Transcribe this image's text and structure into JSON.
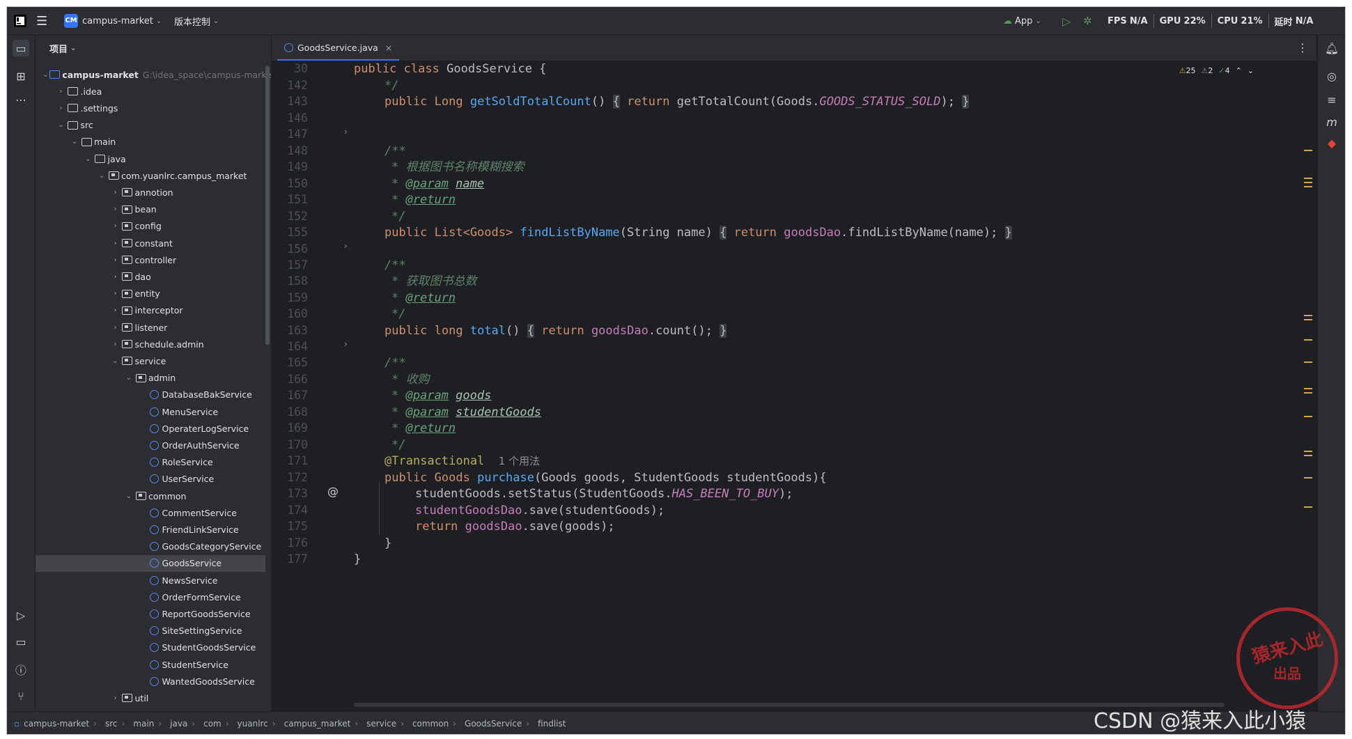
{
  "titlebar": {
    "project_badge": "CM",
    "project_name": "campus-market",
    "vcs": "版本控制",
    "run_config": "App",
    "fps_label": "FPS",
    "fps_value": "N/A",
    "gpu_label": "GPU",
    "gpu_value": "22%",
    "cpu_label": "CPU",
    "cpu_value": "21%",
    "time_label": "延时",
    "time_value": "N/A"
  },
  "project_panel": {
    "title": "项目",
    "tree": [
      {
        "label": "campus-market",
        "extra": "G:\\idea_space\\campus-market",
        "depth": 0,
        "type": "module",
        "arrow": "open"
      },
      {
        "label": ".idea",
        "depth": 1,
        "type": "folder",
        "arrow": "closed"
      },
      {
        "label": ".settings",
        "depth": 1,
        "type": "folder",
        "arrow": "closed"
      },
      {
        "label": "src",
        "depth": 1,
        "type": "folder",
        "arrow": "open"
      },
      {
        "label": "main",
        "depth": 2,
        "type": "folder",
        "arrow": "open"
      },
      {
        "label": "java",
        "depth": 3,
        "type": "folder",
        "arrow": "open"
      },
      {
        "label": "com.yuanlrc.campus_market",
        "depth": 4,
        "type": "package",
        "arrow": "open"
      },
      {
        "label": "annotion",
        "depth": 5,
        "type": "package",
        "arrow": "closed"
      },
      {
        "label": "bean",
        "depth": 5,
        "type": "package",
        "arrow": "closed"
      },
      {
        "label": "config",
        "depth": 5,
        "type": "package",
        "arrow": "closed"
      },
      {
        "label": "constant",
        "depth": 5,
        "type": "package",
        "arrow": "closed"
      },
      {
        "label": "controller",
        "depth": 5,
        "type": "package",
        "arrow": "closed"
      },
      {
        "label": "dao",
        "depth": 5,
        "type": "package",
        "arrow": "closed"
      },
      {
        "label": "entity",
        "depth": 5,
        "type": "package",
        "arrow": "closed"
      },
      {
        "label": "interceptor",
        "depth": 5,
        "type": "package",
        "arrow": "closed"
      },
      {
        "label": "listener",
        "depth": 5,
        "type": "package",
        "arrow": "closed"
      },
      {
        "label": "schedule.admin",
        "depth": 5,
        "type": "package",
        "arrow": "closed"
      },
      {
        "label": "service",
        "depth": 5,
        "type": "package",
        "arrow": "open"
      },
      {
        "label": "admin",
        "depth": 6,
        "type": "package",
        "arrow": "open"
      },
      {
        "label": "DatabaseBakService",
        "depth": 7,
        "type": "class"
      },
      {
        "label": "MenuService",
        "depth": 7,
        "type": "class"
      },
      {
        "label": "OperaterLogService",
        "depth": 7,
        "type": "class"
      },
      {
        "label": "OrderAuthService",
        "depth": 7,
        "type": "class"
      },
      {
        "label": "RoleService",
        "depth": 7,
        "type": "class"
      },
      {
        "label": "UserService",
        "depth": 7,
        "type": "class"
      },
      {
        "label": "common",
        "depth": 6,
        "type": "package",
        "arrow": "open"
      },
      {
        "label": "CommentService",
        "depth": 7,
        "type": "class"
      },
      {
        "label": "FriendLinkService",
        "depth": 7,
        "type": "class"
      },
      {
        "label": "GoodsCategoryService",
        "depth": 7,
        "type": "class"
      },
      {
        "label": "GoodsService",
        "depth": 7,
        "type": "class",
        "selected": true
      },
      {
        "label": "NewsService",
        "depth": 7,
        "type": "class"
      },
      {
        "label": "OrderFormService",
        "depth": 7,
        "type": "class"
      },
      {
        "label": "ReportGoodsService",
        "depth": 7,
        "type": "class"
      },
      {
        "label": "SiteSettingService",
        "depth": 7,
        "type": "class"
      },
      {
        "label": "StudentGoodsService",
        "depth": 7,
        "type": "class"
      },
      {
        "label": "StudentService",
        "depth": 7,
        "type": "class"
      },
      {
        "label": "WantedGoodsService",
        "depth": 7,
        "type": "class"
      },
      {
        "label": "util",
        "depth": 5,
        "type": "package",
        "arrow": "closed"
      }
    ]
  },
  "editor": {
    "tab": "GoodsService.java",
    "warnings": "25",
    "weak_warnings": "2",
    "typos": "4",
    "line_numbers": [
      "30",
      "142",
      "143",
      "146",
      "147",
      "148",
      "149",
      "150",
      "151",
      "152",
      "155",
      "156",
      "157",
      "158",
      "159",
      "160",
      "163",
      "164",
      "165",
      "166",
      "167",
      "168",
      "169",
      "170",
      "171",
      "172",
      "173",
      "174",
      "175",
      "176",
      "177"
    ],
    "lines": {
      "l30_kw1": "public",
      "l30_kw2": "class",
      "l30_name": "GoodsService {",
      "l142": "*/",
      "l143_a": "public Long",
      "l143_fn": "getSoldTotalCount",
      "l143_b": "()",
      "l143_c": "{",
      "l143_ret": "return",
      "l143_d": "getTotalCount(Goods.",
      "l143_cst": "GOODS_STATUS_SOLD",
      "l143_e": ");",
      "l143_f": "}",
      "l147": "/**",
      "l148_star": "*",
      "l148_text": "根据图书名称模糊搜索",
      "l149_star": "*",
      "l149_tag": "@param",
      "l149_name": "name",
      "l150_star": "*",
      "l150_tag": "@return",
      "l151": "*/",
      "l152_a": "public List<Goods>",
      "l152_fn": "findListByName",
      "l152_b": "(String name)",
      "l152_c": "{",
      "l152_ret": "return",
      "l152_fld": "goodsDao",
      "l152_d": ".findListByName(name);",
      "l152_e": "}",
      "l156": "/**",
      "l157_star": "*",
      "l157_text": "获取图书总数",
      "l158_star": "*",
      "l158_tag": "@return",
      "l159": "*/",
      "l160_a": "public long",
      "l160_fn": "total",
      "l160_b": "()",
      "l160_c": "{",
      "l160_ret": "return",
      "l160_fld": "goodsDao",
      "l160_d": ".count();",
      "l160_e": "}",
      "l164": "/**",
      "l165_star": "*",
      "l165_text": "收购",
      "l166_star": "*",
      "l166_tag": "@param",
      "l166_name": "goods",
      "l167_star": "*",
      "l167_tag": "@param",
      "l167_name": "studentGoods",
      "l168_star": "*",
      "l168_tag": "@return",
      "l169": "*/",
      "l170_ann": "@Transactional",
      "l170_usage": "1 个用法",
      "l171_a": "public Goods",
      "l171_fn": "purchase",
      "l171_b": "(Goods goods, StudentGoods studentGoods){",
      "l172_a": "studentGoods.setStatus(StudentGoods.",
      "l172_cst": "HAS_BEEN_TO_BUY",
      "l172_b": ");",
      "l173_fld": "studentGoodsDao",
      "l173_a": ".save(studentGoods);",
      "l174_ret": "return",
      "l174_fld": "goodsDao",
      "l174_a": ".save(goods);",
      "l175": "}",
      "l176": "}"
    }
  },
  "statusbar": {
    "crumbs": [
      "campus-market",
      "src",
      "main",
      "java",
      "com",
      "yuanlrc",
      "campus_market",
      "service",
      "common",
      "GoodsService",
      "findlist"
    ]
  },
  "watermark": {
    "stamp_main": "猿来入此",
    "stamp_sub": "出品",
    "csdn": "CSDN @猿来入此小猿"
  },
  "colors": {
    "accent": "#3574f0",
    "editor_bg": "#1e1f22",
    "panel_bg": "#2b2d30",
    "keyword": "#cf8e6d",
    "method": "#56a8f5",
    "field": "#c77dbb",
    "comment": "#5f826b",
    "annotation": "#b3ae60",
    "warning_marker": "#d5a84d"
  }
}
